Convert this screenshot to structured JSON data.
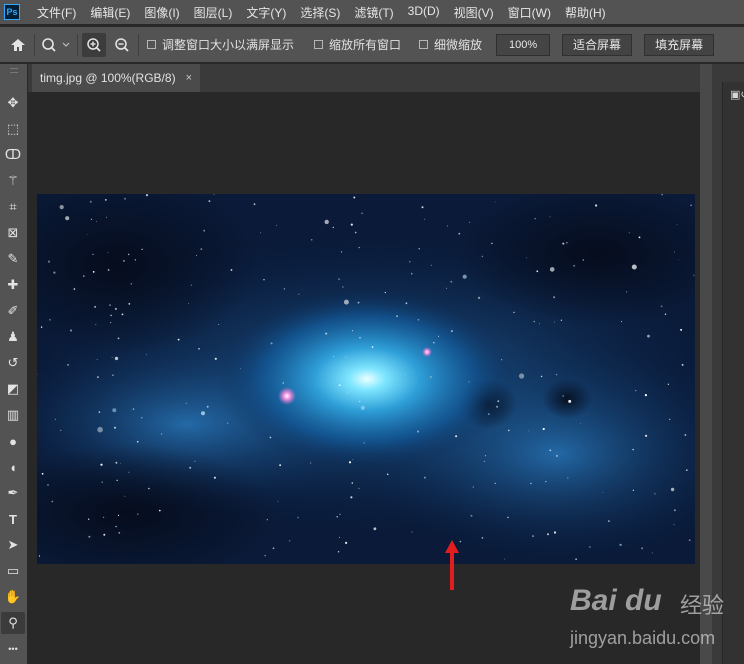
{
  "app": {
    "logo": "Ps"
  },
  "menu": [
    "文件(F)",
    "编辑(E)",
    "图像(I)",
    "图层(L)",
    "文字(Y)",
    "选择(S)",
    "滤镜(T)",
    "3D(D)",
    "视图(V)",
    "窗口(W)",
    "帮助(H)"
  ],
  "options": {
    "home_icon": "home-icon",
    "zoom_tool_icon": "magnifier-icon",
    "zoom_in_icon": "zoom-in-icon",
    "zoom_out_icon": "zoom-out-icon",
    "resize_windows_label": "调整窗口大小以满屏显示",
    "zoom_all_windows_label": "缩放所有窗口",
    "scrubby_zoom_label": "细微缩放",
    "zoom_value": "100%",
    "fit_screen_label": "适合屏幕",
    "fill_screen_label": "填充屏幕"
  },
  "document": {
    "tab_title": "timg.jpg @ 100%(RGB/8)",
    "close_symbol": "×"
  },
  "tools": [
    {
      "name": "move-tool",
      "icon": "move-icon",
      "glyph": "✥"
    },
    {
      "name": "marquee-tool",
      "icon": "rect-marquee-icon",
      "glyph": "⬚"
    },
    {
      "name": "lasso-tool",
      "icon": "lasso-icon",
      "glyph": "ↀ"
    },
    {
      "name": "magic-wand-tool",
      "icon": "magic-wand-icon",
      "glyph": "⚚"
    },
    {
      "name": "crop-tool",
      "icon": "crop-icon",
      "glyph": "⌗"
    },
    {
      "name": "frame-tool",
      "icon": "frame-icon",
      "glyph": "⊠"
    },
    {
      "name": "eyedropper-tool",
      "icon": "eyedropper-icon",
      "glyph": "✎"
    },
    {
      "name": "healing-tool",
      "icon": "bandage-icon",
      "glyph": "✚"
    },
    {
      "name": "brush-tool",
      "icon": "brush-icon",
      "glyph": "✐"
    },
    {
      "name": "stamp-tool",
      "icon": "stamp-icon",
      "glyph": "♟"
    },
    {
      "name": "history-brush-tool",
      "icon": "history-brush-icon",
      "glyph": "↺"
    },
    {
      "name": "eraser-tool",
      "icon": "eraser-icon",
      "glyph": "◩"
    },
    {
      "name": "gradient-tool",
      "icon": "gradient-icon",
      "glyph": "▥"
    },
    {
      "name": "blur-tool",
      "icon": "drop-icon",
      "glyph": "●"
    },
    {
      "name": "dodge-tool",
      "icon": "dodge-icon",
      "glyph": "◖"
    },
    {
      "name": "pen-tool",
      "icon": "pen-icon",
      "glyph": "✒"
    },
    {
      "name": "type-tool",
      "icon": "type-icon",
      "glyph": "T"
    },
    {
      "name": "path-selection-tool",
      "icon": "arrow-cursor-icon",
      "glyph": "➤"
    },
    {
      "name": "rectangle-tool",
      "icon": "rectangle-icon",
      "glyph": "▭"
    },
    {
      "name": "hand-tool",
      "icon": "hand-icon",
      "glyph": "✋"
    },
    {
      "name": "zoom-tool",
      "icon": "zoom-icon",
      "glyph": "⚲"
    },
    {
      "name": "more-tools",
      "icon": "ellipsis-icon",
      "glyph": "•••"
    }
  ],
  "watermark": {
    "logo": "Bai du",
    "brand": "经验",
    "url": "jingyan.baidu.com"
  },
  "colors": {
    "accent_arrow": "#e11d1d",
    "ps_blue": "#31a8ff"
  }
}
